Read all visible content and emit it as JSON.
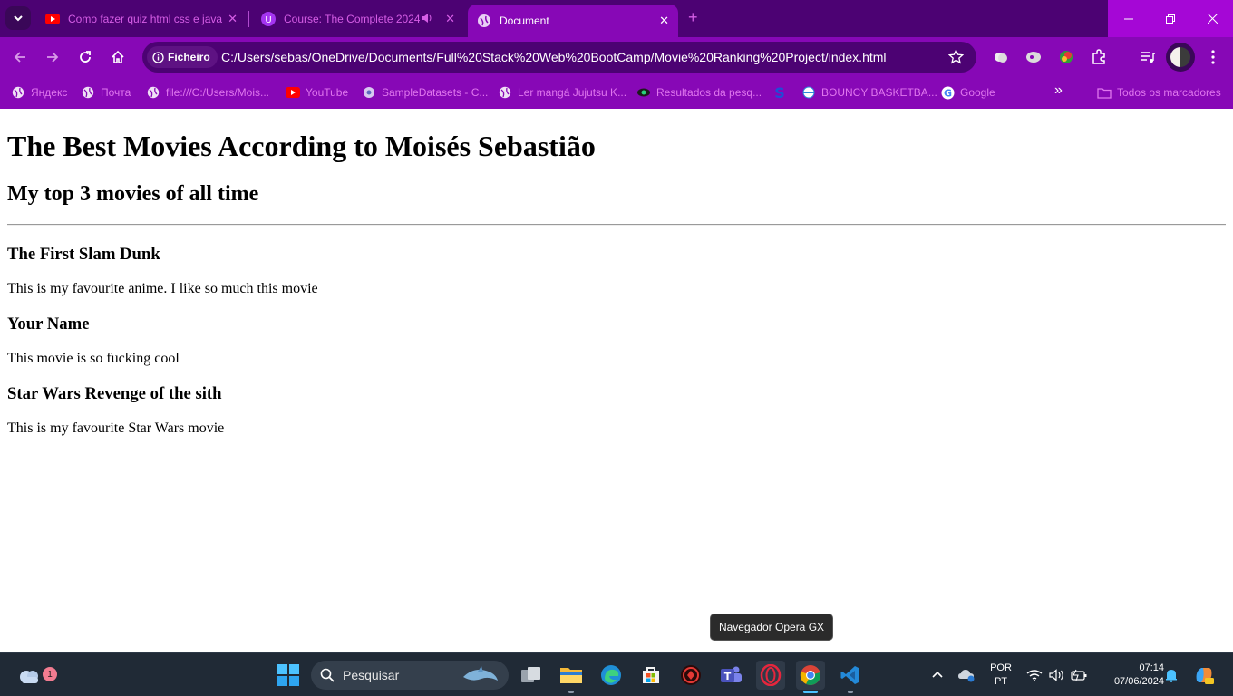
{
  "browser": {
    "tabs": [
      {
        "title": "Como fazer quiz html css e java",
        "icon": "youtube-icon",
        "close": "✕"
      },
      {
        "title": "Course: The Complete 2024",
        "icon": "udemy-icon",
        "close": "✕"
      },
      {
        "title": "Document",
        "icon": "globe-icon",
        "close": "✕"
      }
    ],
    "new_tab": "+",
    "address": {
      "chip_label": "Ficheiro",
      "url": "C:/Users/sebas/OneDrive/Documents/Full%20Stack%20Web%20BootCamp/Movie%20Ranking%20Project/index.html"
    },
    "bookmarks": [
      {
        "label": "Яндекс",
        "icon": "globe-icon"
      },
      {
        "label": "Почта",
        "icon": "globe-icon"
      },
      {
        "label": "file:///C:/Users/Mois...",
        "icon": "globe-icon"
      },
      {
        "label": "YouTube",
        "icon": "youtube-icon"
      },
      {
        "label": "SampleDatasets - C...",
        "icon": "dataset-icon"
      },
      {
        "label": "Ler mangá Jujutsu K...",
        "icon": "globe-icon"
      },
      {
        "label": "Resultados da pesq...",
        "icon": "eye-icon"
      },
      {
        "label": "",
        "icon": "s-logo-icon"
      },
      {
        "label": "BOUNCY BASKETBA...",
        "icon": "ball-icon"
      },
      {
        "label": "Google",
        "icon": "google-icon"
      }
    ],
    "bookmarks_overflow": "»",
    "all_bookmarks": "Todos os marcadores"
  },
  "page": {
    "h1": "The Best Movies According to Moisés Sebastião",
    "h2": "My top 3 movies of all time",
    "movies": [
      {
        "title": "The First Slam Dunk",
        "desc": "This is my favourite anime. I like so much this movie"
      },
      {
        "title": "Your Name",
        "desc": "This movie is so fucking cool"
      },
      {
        "title": "Star Wars Revenge of the sith",
        "desc": "This is my favourite Star Wars movie"
      }
    ]
  },
  "tooltip": "Navegador Opera GX",
  "taskbar": {
    "weather_badge": "1",
    "search_placeholder": "Pesquisar",
    "lang_line1": "POR",
    "lang_line2": "PT",
    "time": "07:14",
    "date": "07/06/2024"
  },
  "colors": {
    "tabstrip": "#4c0273",
    "toolbar": "#8708b6",
    "accent_text": "#d65ee6",
    "taskbar": "#202a36"
  }
}
